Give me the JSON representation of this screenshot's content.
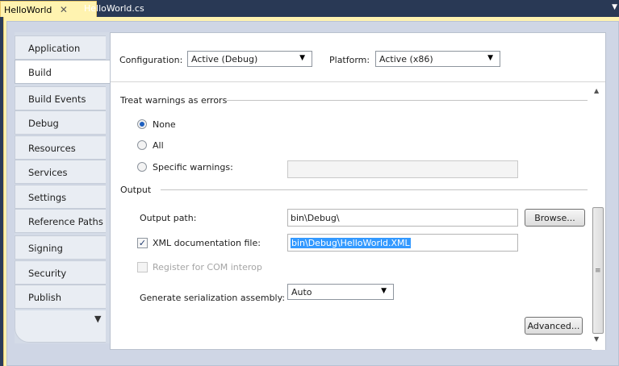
{
  "tabs": [
    {
      "label": "HelloWorld",
      "close": "✕",
      "active": true
    },
    {
      "label": "HelloWorld.cs",
      "active": false
    }
  ],
  "tabstrip_menu_icon": "dropdown-arrow",
  "nav": {
    "items": [
      "Application",
      "Build",
      "Build Events",
      "Debug",
      "Resources",
      "Services",
      "Settings",
      "Reference Paths",
      "Signing",
      "Security",
      "Publish"
    ],
    "active_index": 1,
    "more_glyph": "▼"
  },
  "header": {
    "configuration_label": "Configuration:",
    "configuration_value": "Active (Debug)",
    "platform_label": "Platform:",
    "platform_value": "Active (x86)"
  },
  "warnings": {
    "section_label": "Treat warnings as errors",
    "options": [
      {
        "label": "None",
        "checked": true
      },
      {
        "label": "All",
        "checked": false
      },
      {
        "label": "Specific warnings:",
        "checked": false
      }
    ],
    "specific_value": ""
  },
  "output": {
    "section_label": "Output",
    "path_label": "Output path:",
    "path_value": "bin\\Debug\\",
    "browse_label": "Browse...",
    "xml_label": "XML documentation file:",
    "xml_checked": true,
    "xml_value": "bin\\Debug\\HelloWorld.XML",
    "com_label": "Register for COM interop",
    "com_checked": false,
    "serialization_label": "Generate serialization assembly:",
    "serialization_value": "Auto",
    "advanced_label": "Advanced..."
  },
  "glyphs": {
    "checkmark": "✓",
    "dropdown": "▼",
    "scroll_up": "▲",
    "scroll_down": "▼",
    "grip": "≡"
  },
  "colors": {
    "tabstrip_bg": "#293955",
    "active_tab_bg": "#fff3b0",
    "selection": "#3399ff",
    "radio_dot": "#1d5fbf"
  }
}
